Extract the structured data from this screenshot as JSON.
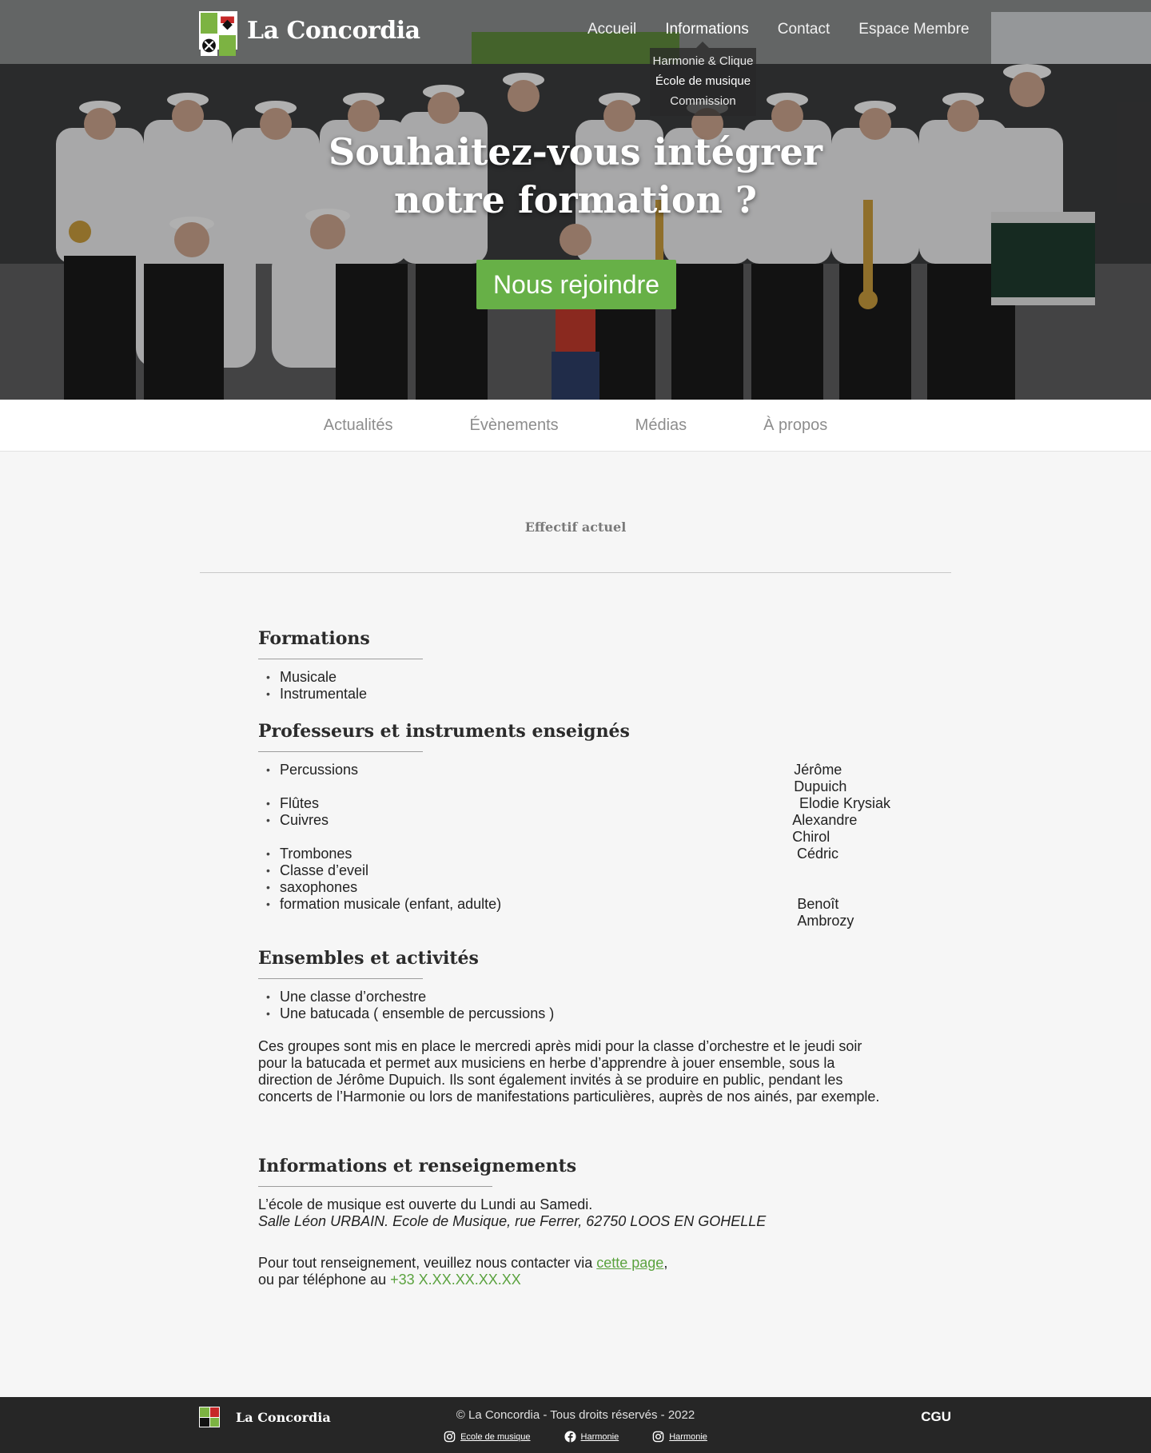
{
  "brand": {
    "name": "La Concordia"
  },
  "topnav": {
    "items": [
      "Accueil",
      "Informations",
      "Contact",
      "Espace Membre"
    ],
    "dropdown": [
      "Harmonie & Clique",
      "École de musique",
      "Commission"
    ]
  },
  "hero": {
    "title_line1": "Souhaitez-vous intégrer",
    "title_line2": "notre formation ?",
    "cta_label": "Nous rejoindre"
  },
  "subnav": [
    "Actualités",
    "Évènements",
    "Médias",
    "À propos"
  ],
  "section_heading": "Effectif actuel",
  "formations": {
    "title": "Formations",
    "items": [
      "Musicale",
      "Instrumentale"
    ]
  },
  "teachers": {
    "title": "Professeurs et instruments enseignés",
    "rows": [
      {
        "instrument": "Percussions",
        "prof": "Jérôme Dupuich"
      },
      {
        "instrument": "Flûtes",
        "prof": "Elodie Krysiak"
      },
      {
        "instrument": "Cuivres",
        "prof": "Alexandre Chirol"
      },
      {
        "instrument": "Trombones",
        "prof": "Cédric"
      },
      {
        "instrument": "Classe d’eveil",
        "prof": ""
      },
      {
        "instrument": "saxophones",
        "prof": ""
      },
      {
        "instrument": "formation musicale (enfant, adulte)",
        "prof": "Benoît Ambrozy"
      }
    ]
  },
  "ensembles": {
    "title": "Ensembles et activités",
    "items": [
      "Une classe d’orchestre",
      "Une batucada ( ensemble de percussions )"
    ],
    "paragraph": "Ces groupes sont mis en place le mercredi après midi pour la classe d’orchestre et le jeudi soir pour la batucada et permet aux musiciens en herbe d’apprendre à jouer ensemble, sous la direction de Jérôme Dupuich. Ils sont également invités à se produire en public, pendant les concerts de l’Harmonie ou lors de manifestations particulières, auprès de nos ainés, par exemple."
  },
  "info": {
    "title": "Informations et renseignements",
    "opening": "L’école de musique est ouverte du Lundi au Samedi.",
    "address": "Salle Léon URBAIN. Ecole de Musique, rue Ferrer, 62750 LOOS EN GOHELLE",
    "contact_prefix": "Pour tout renseignement, veuillez nous contacter via ",
    "contact_link": "cette page",
    "contact_suffix": ",",
    "phone_prefix": "ou par téléphone au ",
    "phone": "+33 X.XX.XX.XX.XX"
  },
  "footer": {
    "brand": "La Concordia",
    "copyright": "© La Concordia - Tous droits réservés - 2022",
    "links": [
      {
        "icon": "instagram-icon",
        "label": "Ecole de musique"
      },
      {
        "icon": "facebook-icon",
        "label": "Harmonie"
      },
      {
        "icon": "instagram-icon",
        "label": "Harmonie"
      }
    ],
    "cgu": "CGU"
  },
  "colors": {
    "accent": "#67b047",
    "link": "#5aa23e",
    "footer_bg": "#262626"
  }
}
